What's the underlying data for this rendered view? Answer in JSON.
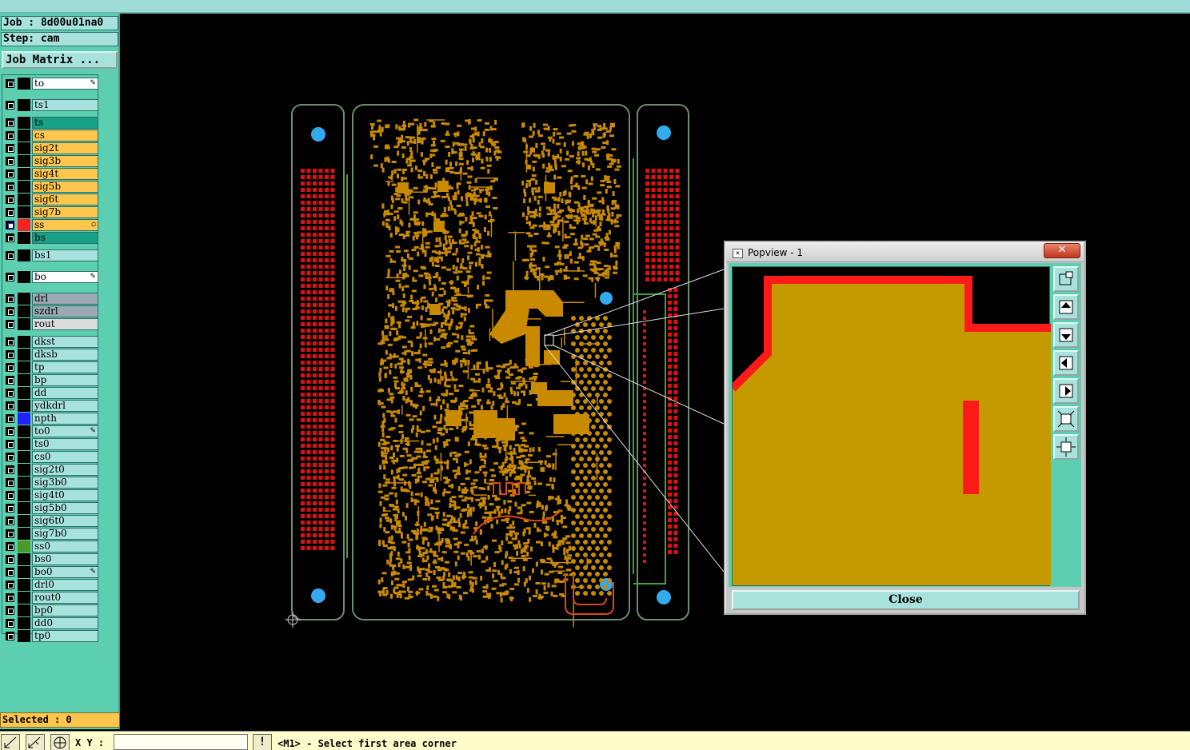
{
  "left_panel": {
    "job_label": "Job : 8d00u01na0",
    "step_label": "Step: cam",
    "job_matrix_button": "Job Matrix ...",
    "selected": "Selected : 0"
  },
  "layers": [
    {
      "name": "to",
      "bg": "#ffffff",
      "swatch": "#000000",
      "mark": "✎"
    },
    {
      "name": "ts1",
      "bg": "#a8e2dd",
      "swatch": "#000000",
      "mark": ""
    },
    {
      "name": "ts",
      "bg": "#16a085",
      "swatch": "#000000",
      "mark": ""
    },
    {
      "name": "cs",
      "bg": "#ffc64d",
      "swatch": "#000000",
      "mark": ""
    },
    {
      "name": "sig2t",
      "bg": "#ffc64d",
      "swatch": "#000000",
      "mark": ""
    },
    {
      "name": "sig3b",
      "bg": "#ffc64d",
      "swatch": "#000000",
      "mark": ""
    },
    {
      "name": "sig4t",
      "bg": "#ffc64d",
      "swatch": "#000000",
      "mark": ""
    },
    {
      "name": "sig5b",
      "bg": "#ffc64d",
      "swatch": "#000000",
      "mark": ""
    },
    {
      "name": "sig6t",
      "bg": "#ffc64d",
      "swatch": "#000000",
      "mark": ""
    },
    {
      "name": "sig7b",
      "bg": "#ffc64d",
      "swatch": "#000000",
      "mark": ""
    },
    {
      "name": "ss",
      "bg": "#ffc64d",
      "swatch": "#ff2020",
      "mark": "▫",
      "selected": true
    },
    {
      "name": "bs",
      "bg": "#16a085",
      "swatch": "#000000",
      "mark": ""
    },
    {
      "name": "bs1",
      "bg": "#a8e2dd",
      "swatch": "#000000",
      "mark": ""
    },
    {
      "name": "bo",
      "bg": "#ffffff",
      "swatch": "#000000",
      "mark": "✎"
    },
    {
      "name": "drl",
      "bg": "#9aa9b4",
      "swatch": "#000000",
      "mark": ""
    },
    {
      "name": "szdrl",
      "bg": "#9aa9b4",
      "swatch": "#000000",
      "mark": ""
    },
    {
      "name": "rout",
      "bg": "#dcdcdc",
      "swatch": "#000000",
      "mark": ""
    },
    {
      "name": "dkst",
      "bg": "#a8e2dd",
      "swatch": "#000000",
      "mark": ""
    },
    {
      "name": "dksb",
      "bg": "#a8e2dd",
      "swatch": "#000000",
      "mark": ""
    },
    {
      "name": "tp",
      "bg": "#a8e2dd",
      "swatch": "#000000",
      "mark": ""
    },
    {
      "name": "bp",
      "bg": "#a8e2dd",
      "swatch": "#000000",
      "mark": ""
    },
    {
      "name": "dd",
      "bg": "#a8e2dd",
      "swatch": "#000000",
      "mark": ""
    },
    {
      "name": "ydkdrl",
      "bg": "#a8e2dd",
      "swatch": "#000000",
      "mark": ""
    },
    {
      "name": "npth",
      "bg": "#a8e2dd",
      "swatch": "#2222ff",
      "mark": ""
    },
    {
      "name": "to0",
      "bg": "#a8e2dd",
      "swatch": "#000000",
      "mark": "✎"
    },
    {
      "name": "ts0",
      "bg": "#a8e2dd",
      "swatch": "#000000",
      "mark": ""
    },
    {
      "name": "cs0",
      "bg": "#a8e2dd",
      "swatch": "#000000",
      "mark": ""
    },
    {
      "name": "sig2t0",
      "bg": "#a8e2dd",
      "swatch": "#000000",
      "mark": ""
    },
    {
      "name": "sig3b0",
      "bg": "#a8e2dd",
      "swatch": "#000000",
      "mark": ""
    },
    {
      "name": "sig4t0",
      "bg": "#a8e2dd",
      "swatch": "#000000",
      "mark": ""
    },
    {
      "name": "sig5b0",
      "bg": "#a8e2dd",
      "swatch": "#000000",
      "mark": ""
    },
    {
      "name": "sig6t0",
      "bg": "#a8e2dd",
      "swatch": "#000000",
      "mark": ""
    },
    {
      "name": "sig7b0",
      "bg": "#a8e2dd",
      "swatch": "#000000",
      "mark": ""
    },
    {
      "name": "ss0",
      "bg": "#a8e2dd",
      "swatch": "#4a9a2a",
      "mark": ""
    },
    {
      "name": "bs0",
      "bg": "#a8e2dd",
      "swatch": "#000000",
      "mark": ""
    },
    {
      "name": "bo0",
      "bg": "#a8e2dd",
      "swatch": "#000000",
      "mark": "✎"
    },
    {
      "name": "drl0",
      "bg": "#a8e2dd",
      "swatch": "#000000",
      "mark": ""
    },
    {
      "name": "rout0",
      "bg": "#a8e2dd",
      "swatch": "#000000",
      "mark": ""
    },
    {
      "name": "bp0",
      "bg": "#a8e2dd",
      "swatch": "#000000",
      "mark": ""
    },
    {
      "name": "dd0",
      "bg": "#a8e2dd",
      "swatch": "#000000",
      "mark": ""
    },
    {
      "name": "tp0",
      "bg": "#a8e2dd",
      "swatch": "#000000",
      "mark": ""
    }
  ],
  "status_bar": {
    "xy_label": "X Y :",
    "xy_value": "",
    "exclaim": "!",
    "message": "<M1> - Select first area corner"
  },
  "popview": {
    "title": "Popview - 1",
    "close_button": "Close",
    "title_close": "✕",
    "tool_icons": [
      "zoom-fit-icon",
      "pan-up-icon",
      "pan-down-icon",
      "pan-left-icon",
      "pan-right-icon",
      "zoom-in-icon",
      "zoom-out-icon"
    ]
  },
  "colors": {
    "copper": "#c49a00",
    "soldermask": "#ff1a1a",
    "outline": "#5a8a5a",
    "hole": "#33aaee",
    "panel": "#5ccfb0"
  }
}
